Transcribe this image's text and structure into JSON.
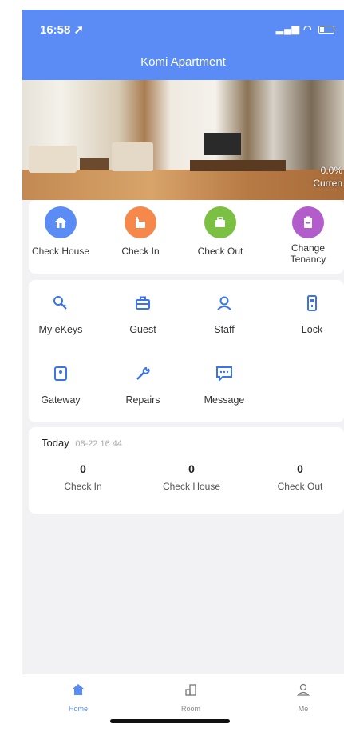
{
  "status_bar": {
    "time": "16:58 ➚"
  },
  "header": {
    "title": "Komi Apartment"
  },
  "hero": {
    "percent": "0.0%",
    "caption": "Curren"
  },
  "quick_actions": [
    {
      "label": "Check House",
      "color": "#5b8cf5",
      "icon": "house-icon"
    },
    {
      "label": "Check In",
      "color": "#f5884a",
      "icon": "check-in-icon"
    },
    {
      "label": "Check Out",
      "color": "#7bc043",
      "icon": "check-out-icon"
    },
    {
      "label": "Change Tenancy",
      "color": "#b35ccc",
      "icon": "change-tenancy-icon"
    }
  ],
  "tools": [
    {
      "label": "My eKeys",
      "icon": "key-icon"
    },
    {
      "label": "Guest",
      "icon": "briefcase-icon"
    },
    {
      "label": "Staff",
      "icon": "staff-icon"
    },
    {
      "label": "Lock",
      "icon": "lock-icon"
    },
    {
      "label": "Gateway",
      "icon": "gateway-icon"
    },
    {
      "label": "Repairs",
      "icon": "wrench-icon"
    },
    {
      "label": "Message",
      "icon": "message-icon"
    }
  ],
  "today": {
    "title": "Today",
    "timestamp": "08-22 16:44",
    "stats": [
      {
        "value": "0",
        "label": "Check In"
      },
      {
        "value": "0",
        "label": "Check House"
      },
      {
        "value": "0",
        "label": "Check Out"
      }
    ]
  },
  "tabs": [
    {
      "label": "Home",
      "icon": "home-icon",
      "active": true
    },
    {
      "label": "Room",
      "icon": "room-icon",
      "active": false
    },
    {
      "label": "Me",
      "icon": "person-icon",
      "active": false
    }
  ],
  "colors": {
    "primary": "#5b8cf5",
    "tab_active": "#5b8cf5",
    "tab_inactive": "#888888"
  }
}
